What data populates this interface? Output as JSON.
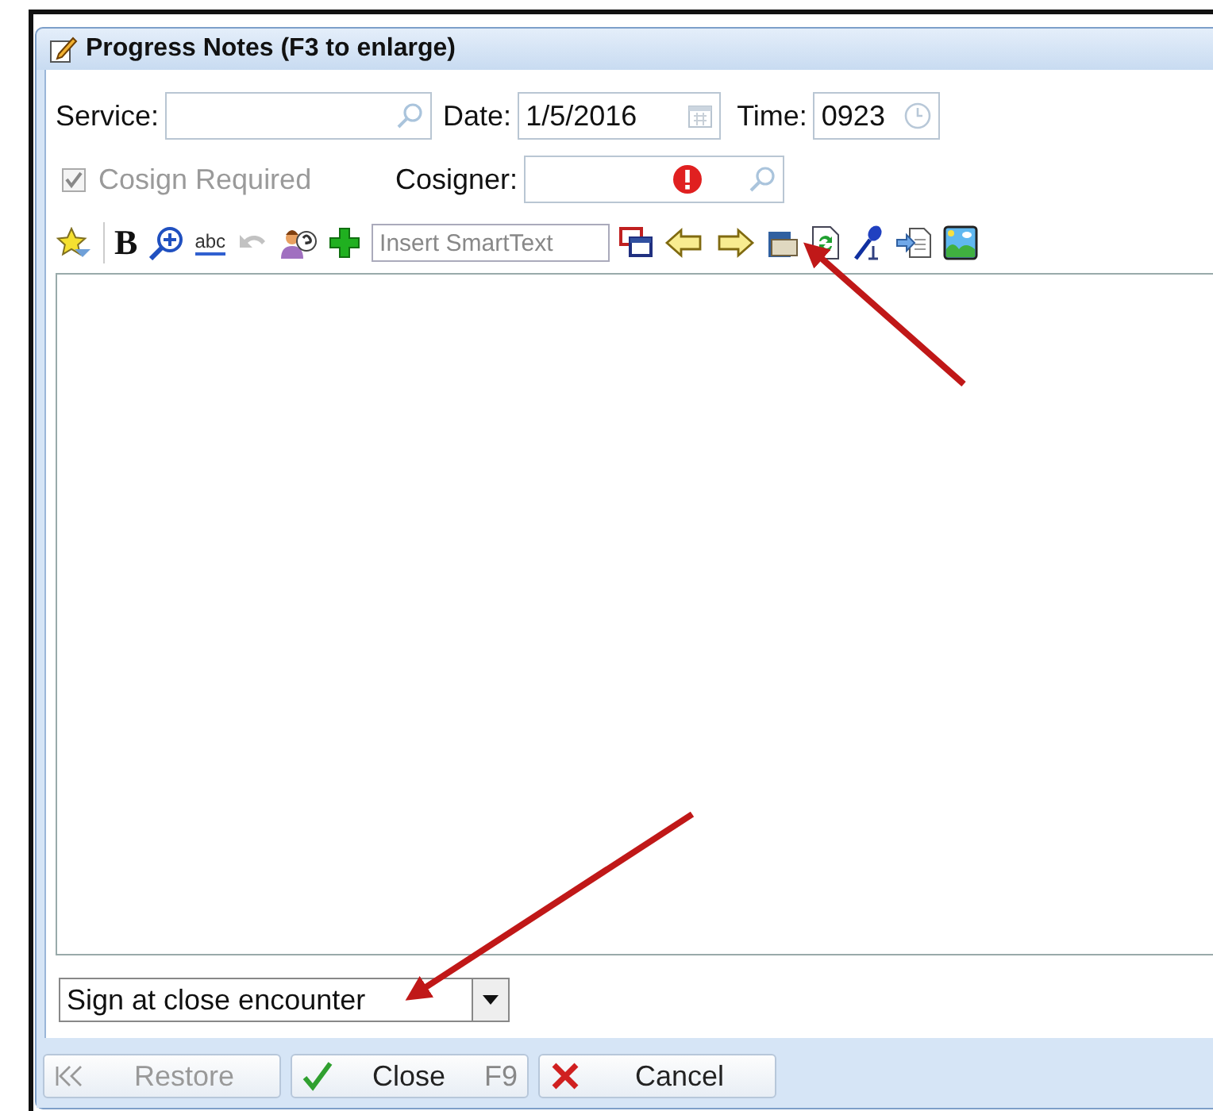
{
  "window": {
    "title": "Progress Notes (F3 to enlarge)"
  },
  "fields": {
    "service": {
      "label": "Service:"
    },
    "date": {
      "label": "Date:",
      "value": "1/5/2016"
    },
    "time": {
      "label": "Time:",
      "value": "0923"
    }
  },
  "cosign_required": {
    "label": "Cosign Required",
    "checked": true,
    "disabled": true
  },
  "cosigner": {
    "label": "Cosigner:",
    "error": true
  },
  "toolbar": [
    {
      "kind": "star"
    },
    {
      "kind": "separator"
    },
    {
      "kind": "bold",
      "label": "B"
    },
    {
      "kind": "zoom"
    },
    {
      "kind": "spell",
      "label": "abc"
    },
    {
      "kind": "undo",
      "disabled": true
    },
    {
      "kind": "help"
    },
    {
      "kind": "plus"
    },
    {
      "kind": "smarttext",
      "placeholder": "Insert SmartText"
    },
    {
      "kind": "windows"
    },
    {
      "kind": "left"
    },
    {
      "kind": "right"
    },
    {
      "kind": "template"
    },
    {
      "kind": "refresh"
    },
    {
      "kind": "mic"
    },
    {
      "kind": "import"
    },
    {
      "kind": "image"
    }
  ],
  "sign_option": {
    "value": "Sign at close encounter"
  },
  "buttons": [
    {
      "kind": "restore",
      "label": "Restore",
      "disabled": true
    },
    {
      "kind": "close",
      "label": "Close",
      "shortcut": "F9",
      "disabled": false
    },
    {
      "kind": "cancel",
      "label": "Cancel",
      "disabled": false
    }
  ]
}
